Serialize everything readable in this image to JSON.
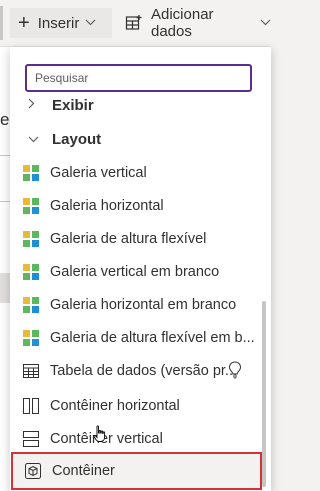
{
  "toolbar": {
    "insert_label": "Inserir",
    "add_data_label": "Adicionar dados"
  },
  "background": {
    "letter": "e"
  },
  "search": {
    "placeholder": "Pesquisar"
  },
  "menu": {
    "collapsed_section": "Exibir",
    "section": "Layout",
    "items": [
      {
        "label": "Galeria vertical",
        "icon": "gallery-icon"
      },
      {
        "label": "Galeria horizontal",
        "icon": "gallery-icon"
      },
      {
        "label": "Galeria de altura flexível",
        "icon": "gallery-icon"
      },
      {
        "label": "Galeria vertical em branco",
        "icon": "gallery-icon"
      },
      {
        "label": "Galeria horizontal em branco",
        "icon": "gallery-icon"
      },
      {
        "label": "Galeria de altura flexível em b...",
        "icon": "gallery-icon"
      },
      {
        "label": "Tabela de dados (versão pr...",
        "icon": "table-icon"
      },
      {
        "label": "Contêiner horizontal",
        "icon": "horizontal-container-icon"
      },
      {
        "label": "Contêiner vertical",
        "icon": "vertical-container-icon"
      },
      {
        "label": "Contêiner",
        "icon": "container-icon"
      }
    ]
  },
  "colors": {
    "accent": "#5c2d91",
    "highlight_border": "#d13438",
    "gallery_yellow": "#e8b93b",
    "gallery_green": "#5cb85c",
    "gallery_blue": "#1f8fd6"
  }
}
